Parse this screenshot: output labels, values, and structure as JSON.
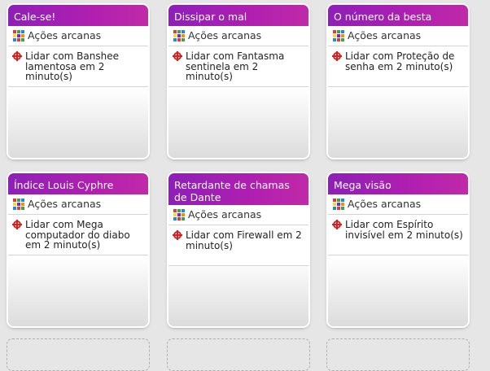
{
  "category_label": "Ações arcanas",
  "cards": [
    {
      "title": "Cale-se!",
      "task": "Lidar com Banshee lamentosa em 2 minuto(s)"
    },
    {
      "title": "Dissipar o mal",
      "task": "Lidar com Fantasma sentinela em 2 minuto(s)"
    },
    {
      "title": "O número da besta",
      "task": "Lidar com Proteção de senha em 2 minuto(s)"
    },
    {
      "title": "Índice Louis Cyphre",
      "task": "Lidar com Mega computador do diabo em 2 minuto(s)"
    },
    {
      "title": "Retardante de chamas de Dante",
      "task": "Lidar com Firewall em 2 minuto(s)"
    },
    {
      "title": "Mega visão",
      "task": "Lidar com Espírito invisível em 2 minuto(s)"
    }
  ],
  "icons": {
    "category": "arcane-grid-icon",
    "task": "target-crosshair-icon"
  },
  "colors": {
    "title_bar": "#a01fb4",
    "target": "#d42020",
    "background": "#e6e6e6"
  }
}
